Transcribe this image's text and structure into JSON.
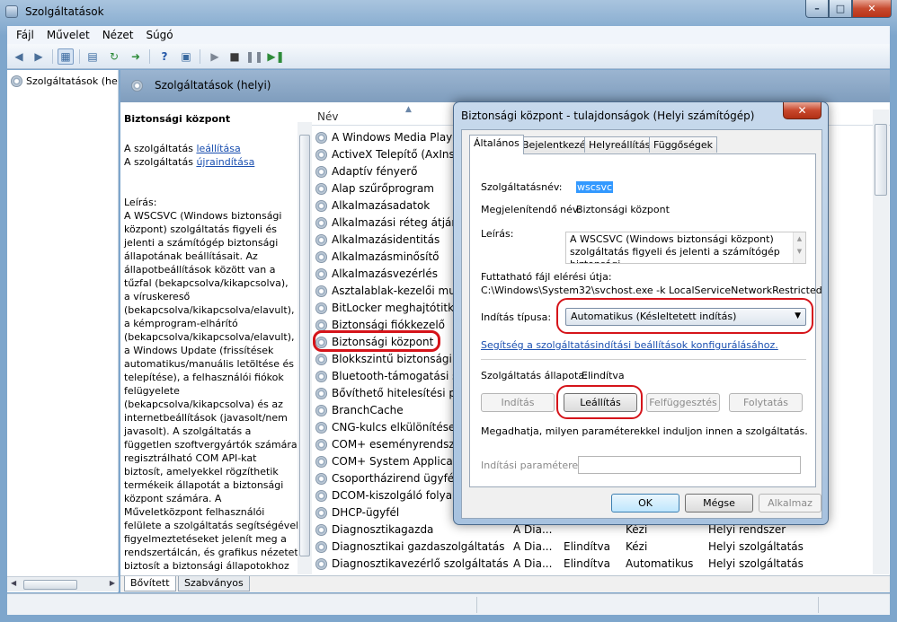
{
  "window": {
    "title": "Szolgáltatások",
    "min": "–",
    "max": "□",
    "close": "✕"
  },
  "menu": [
    "Fájl",
    "Művelet",
    "Nézet",
    "Súgó"
  ],
  "toolbar_icons": [
    "back-arrow-icon",
    "forward-arrow-icon",
    "console-tree-icon",
    "list-icon",
    "refresh-icon",
    "export-icon",
    "help-icon",
    "properties-icon",
    "play-icon",
    "stop-icon",
    "pause-icon",
    "restart-icon"
  ],
  "tree": {
    "item": "Szolgáltatások (he"
  },
  "panel": {
    "header": "Szolgáltatások (helyi)"
  },
  "desc": {
    "title": "Biztonsági központ",
    "line1_prefix": "A szolgáltatás ",
    "line1_link": "leállítása",
    "line2_prefix": "A szolgáltatás ",
    "line2_link": "újraindítása",
    "label": "Leírás:",
    "lines": [
      "A WSCSVC (Windows biztonsági",
      "központ) szolgáltatás figyeli és",
      "jelenti a számítógép biztonsági",
      "állapotának beállításait. Az",
      "állapotbeállítások között van a",
      "tűzfal (bekapcsolva/kikapcsolva),",
      "a víruskereső",
      "(bekapcsolva/kikapcsolva/elavult),",
      "a kémprogram-elhárító",
      "(bekapcsolva/kikapcsolva/elavult),",
      "a Windows Update (frissítések",
      "automatikus/manuális letöltése és",
      "telepítése), a felhasználói fiókok",
      "felügyelete",
      "(bekapcsolva/kikapcsolva) és az",
      "internetbeállítások (javasolt/nem",
      "javasolt). A szolgáltatás a",
      "független szoftvergyártók számára",
      "regisztrálható COM API-kat",
      "biztosít, amelyekkel rögzíthetik",
      "termékeik állapotát a biztonsági",
      "központ számára. A",
      "Műveletközpont felhasználói",
      "felülete a szolgáltatás segítségével",
      "figyelmeztetéseket jelenít meg a",
      "rendszertálcán, és grafikus nézetet",
      "biztosít a biztonsági állapotokhoz"
    ]
  },
  "list": {
    "col_name": "Név",
    "rows": [
      {
        "name": "A Windows Media Player",
        "desc": "",
        "status": "",
        "type": "",
        "logon": ""
      },
      {
        "name": "ActiveX Telepítő (AxInstSV",
        "desc": "",
        "status": "",
        "type": "",
        "logon": ""
      },
      {
        "name": "Adaptív fényerő",
        "desc": "",
        "status": "",
        "type": "",
        "logon": ""
      },
      {
        "name": "Alap szűrőprogram",
        "desc": "",
        "status": "",
        "type": "",
        "logon": ""
      },
      {
        "name": "Alkalmazásadatok",
        "desc": "",
        "status": "",
        "type": "",
        "logon": ""
      },
      {
        "name": "Alkalmazási réteg átjárós",
        "desc": "",
        "status": "",
        "type": "",
        "logon": ""
      },
      {
        "name": "Alkalmazásidentitás",
        "desc": "",
        "status": "",
        "type": "",
        "logon": ""
      },
      {
        "name": "Alkalmazásminősítő",
        "desc": "",
        "status": "",
        "type": "",
        "logon": ""
      },
      {
        "name": "Alkalmazásvezérlés",
        "desc": "",
        "status": "",
        "type": "",
        "logon": ""
      },
      {
        "name": "Asztalablak-kezelői munk",
        "desc": "",
        "status": "",
        "type": "",
        "logon": ""
      },
      {
        "name": "BitLocker meghajtótitkos",
        "desc": "",
        "status": "",
        "type": "",
        "logon": ""
      },
      {
        "name": "Biztonsági fiókkezelő",
        "desc": "",
        "status": "",
        "type": "",
        "logon": ""
      },
      {
        "name": "Biztonsági központ",
        "desc": "",
        "status": "",
        "type": "",
        "logon": ""
      },
      {
        "name": "Blokkszintű biztonsági me",
        "desc": "",
        "status": "",
        "type": "",
        "logon": ""
      },
      {
        "name": "Bluetooth-támogatási szo",
        "desc": "",
        "status": "",
        "type": "",
        "logon": ""
      },
      {
        "name": "Bővíthető hitelesítési prot",
        "desc": "",
        "status": "",
        "type": "",
        "logon": ""
      },
      {
        "name": "BranchCache",
        "desc": "",
        "status": "",
        "type": "",
        "logon": ""
      },
      {
        "name": "CNG-kulcs elkülönítése",
        "desc": "",
        "status": "",
        "type": "",
        "logon": ""
      },
      {
        "name": "COM+ eseményrendszer",
        "desc": "",
        "status": "",
        "type": "",
        "logon": ""
      },
      {
        "name": "COM+ System Applicatio",
        "desc": "",
        "status": "",
        "type": "",
        "logon": ""
      },
      {
        "name": "Csoportházirend ügyfél",
        "desc": "",
        "status": "",
        "type": "",
        "logon": ""
      },
      {
        "name": "DCOM-kiszolgáló folyam",
        "desc": "",
        "status": "",
        "type": "",
        "logon": ""
      },
      {
        "name": "DHCP-ügyfél",
        "desc": "",
        "status": "",
        "type": "",
        "logon": ""
      },
      {
        "name": "Diagnosztikagazda",
        "desc": "A Dia...",
        "status": "",
        "type": "Kézi",
        "logon": "Helyi rendszer"
      },
      {
        "name": "Diagnosztikai gazdaszolgáltatás",
        "desc": "A Dia...",
        "status": "Elindítva",
        "type": "Kézi",
        "logon": "Helyi szolgáltatás"
      },
      {
        "name": "Diagnosztikavezérlő szolgáltatás",
        "desc": "A Dia...",
        "status": "Elindítva",
        "type": "Automatikus",
        "logon": "Helyi szolgáltatás"
      }
    ]
  },
  "bottom_tabs": [
    "Bővített",
    "Szabványos"
  ],
  "dialog": {
    "title": "Biztonsági központ - tulajdonságok (Helyi számítógép)",
    "close": "✕",
    "tabs": [
      "Általános",
      "Bejelentkezés",
      "Helyreállítás",
      "Függőségek"
    ],
    "service_name_label": "Szolgáltatásnév:",
    "service_name_value": "wscsvc",
    "display_name_label": "Megjelenítendő név:",
    "display_name_value": "Biztonsági központ",
    "description_label": "Leírás:",
    "description_line1": "A WSCSVC (Windows biztonsági központ)",
    "description_line2": "szolgáltatás figyeli és jelenti a számítógép biztonsági",
    "exe_label": "Futtatható fájl elérési útja:",
    "exe_value": "C:\\Windows\\System32\\svchost.exe -k LocalServiceNetworkRestricted",
    "startup_type_label": "Indítás típusa:",
    "startup_type_value": "Automatikus (Késleltetett indítás)",
    "help_link": "Segítség a szolgáltatásindítási beállítások konfigurálásához.",
    "status_label": "Szolgáltatás állapota:",
    "status_value": "Elindítva",
    "btn_start": "Indítás",
    "btn_stop": "Leállítás",
    "btn_pause": "Felfüggesztés",
    "btn_resume": "Folytatás",
    "hint": "Megadhatja, milyen paraméterekkel induljon innen a szolgáltatás.",
    "params_label": "Indítási paraméterek:",
    "params_value": "",
    "ok": "OK",
    "cancel": "Mégse",
    "apply": "Alkalmaz"
  }
}
